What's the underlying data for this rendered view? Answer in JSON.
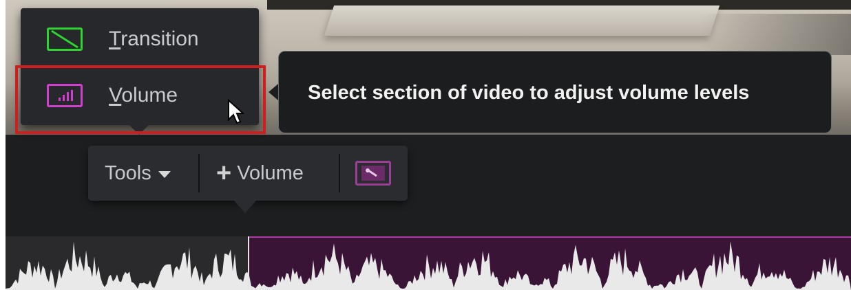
{
  "menu": {
    "items": [
      {
        "label_prefix": "T",
        "label_rest": "ransition",
        "icon": "transition-icon",
        "color": "#2ed52e"
      },
      {
        "label_prefix": "V",
        "label_rest": "olume",
        "icon": "volume-icon",
        "color": "#d03fcd"
      }
    ]
  },
  "tooltip": {
    "text": "Select section of video to adjust volume levels"
  },
  "toolbar": {
    "tools_label": "Tools",
    "add_volume_label": "Volume",
    "plus_glyph": "+",
    "keyframe_icon": "volume-keyframe-icon",
    "accent": "#9b3e98"
  },
  "colors": {
    "highlight": "#d01d1d",
    "selection": "#3a1436",
    "selection_border": "#b23aa8"
  }
}
